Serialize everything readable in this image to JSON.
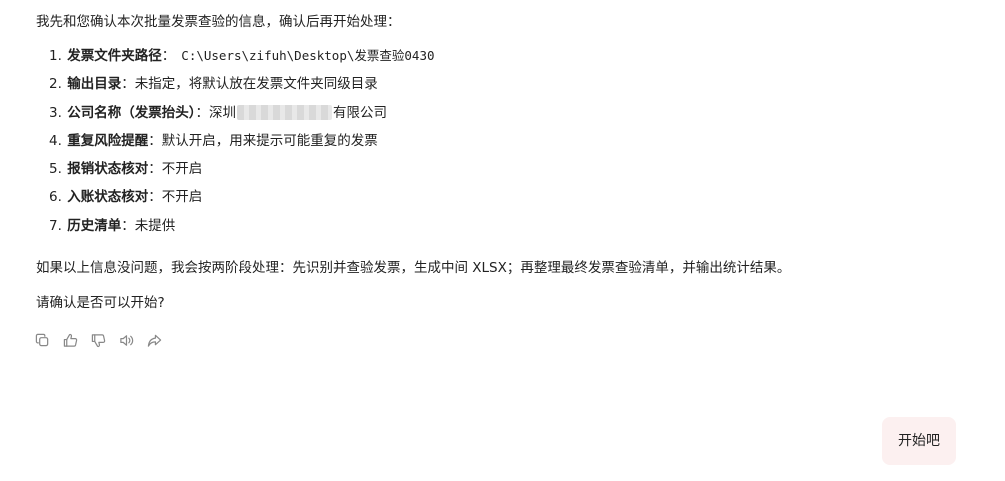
{
  "assistant_message": {
    "intro": "我先和您确认本次批量发票查验的信息，确认后再开始处理：",
    "items": [
      {
        "num": "1.",
        "label": "发票文件夹路径",
        "sep": "：",
        "value": "C:\\Users\\zifuh\\Desktop\\发票查验0430"
      },
      {
        "num": "2.",
        "label": "输出目录",
        "sep": "：",
        "value": "未指定，将默认放在发票文件夹同级目录"
      },
      {
        "num": "3.",
        "label": "公司名称（发票抬头）",
        "sep": "：",
        "value_prefix": "深圳",
        "value_suffix": "有限公司"
      },
      {
        "num": "4.",
        "label": "重复风险提醒",
        "sep": "：",
        "value": "默认开启，用来提示可能重复的发票"
      },
      {
        "num": "5.",
        "label": "报销状态核对",
        "sep": "：",
        "value": "不开启"
      },
      {
        "num": "6.",
        "label": "入账状态核对",
        "sep": "：",
        "value": "不开启"
      },
      {
        "num": "7.",
        "label": "历史清单",
        "sep": "：",
        "value": "未提供"
      }
    ],
    "paragraph_1": "如果以上信息没问题，我会按两阶段处理：先识别并查验发票，生成中间 XLSX；再整理最终发票查验清单，并输出统计结果。",
    "paragraph_2": "请确认是否可以开始?"
  },
  "actions": [
    {
      "icon": "copy-icon"
    },
    {
      "icon": "thumbs-up-icon"
    },
    {
      "icon": "thumbs-down-icon"
    },
    {
      "icon": "speaker-icon"
    },
    {
      "icon": "share-icon"
    }
  ],
  "user_message": {
    "text": "开始吧"
  },
  "colors": {
    "text": "#222222",
    "icon": "#888888",
    "user_bubble_bg": "#fcf0f0",
    "background": "#ffffff"
  }
}
